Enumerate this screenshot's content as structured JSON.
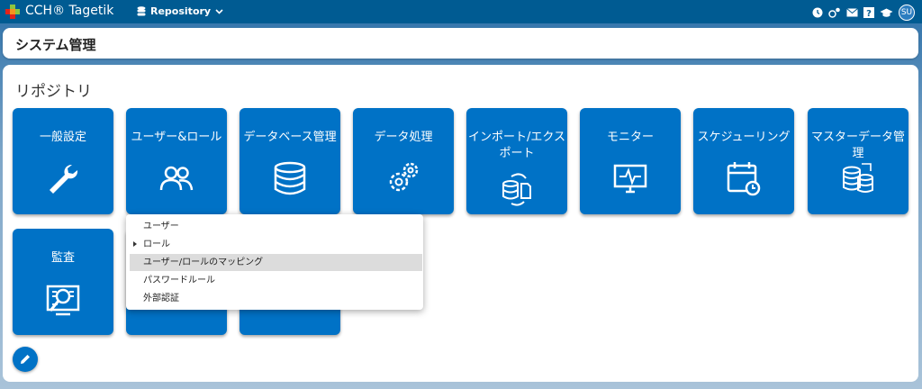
{
  "header": {
    "brand": "CCH® Tagetik",
    "repository_label": "Repository",
    "avatar_initials": "SU"
  },
  "page_title": "システム管理",
  "section_title": "リポジトリ",
  "tiles": [
    {
      "label": "一般設定",
      "icon": "wrench-icon"
    },
    {
      "label": "ユーザー&ロール",
      "icon": "users-icon"
    },
    {
      "label": "データベース管理",
      "icon": "database-icon"
    },
    {
      "label": "データ処理",
      "icon": "gears-icon"
    },
    {
      "label": "インポート/エクスポート",
      "icon": "import-export-icon"
    },
    {
      "label": "モニター",
      "icon": "monitor-icon"
    },
    {
      "label": "スケジューリング",
      "icon": "calendar-clock-icon"
    },
    {
      "label": "マスターデータ管理",
      "icon": "master-data-icon"
    },
    {
      "label": "監査",
      "icon": "audit-icon"
    }
  ],
  "dropdown": {
    "items": [
      {
        "label": "ユーザー"
      },
      {
        "label": "ロール"
      },
      {
        "label": "ユーザー/ロールのマッピング"
      },
      {
        "label": "パスワードルール"
      },
      {
        "label": "外部認証"
      }
    ],
    "highlighted_index": 2
  },
  "colors": {
    "topbar": "#005b92",
    "tile": "#0072c6",
    "highlight": "#dcdcdc"
  }
}
